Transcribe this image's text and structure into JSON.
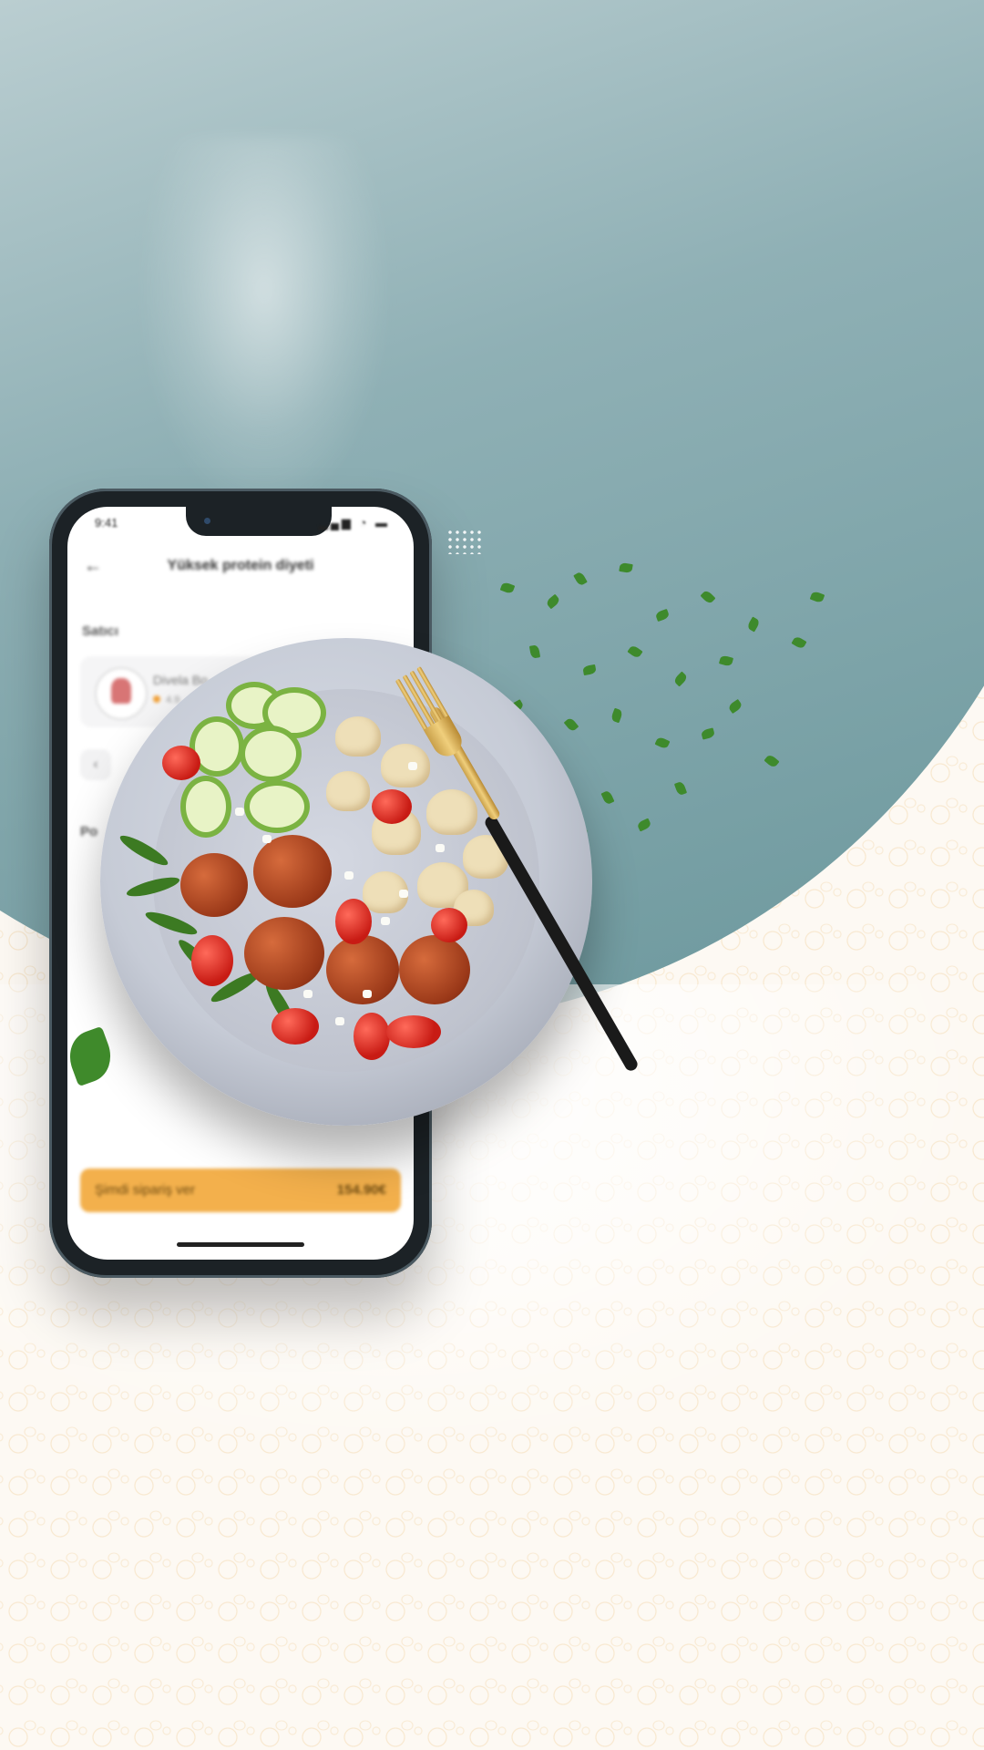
{
  "phone": {
    "status_time": "9:41",
    "status_icons": "▂▄▆ ◔ ▬",
    "back_icon": "arrow-left-icon",
    "title": "Yüksek protein diyeti",
    "seller_section_label": "Satıcı",
    "seller": {
      "name": "Divela Bo",
      "rating": "4.9"
    },
    "nav_prev_icon": "chevron-left-icon",
    "cut_label": "Po",
    "order_button_label": "Şimdi sipariş ver",
    "order_price": "154.90€"
  },
  "colors": {
    "teal_blob": "#8fb0b5",
    "order_button": "#f3b04c",
    "pattern": "#ecbe78"
  }
}
